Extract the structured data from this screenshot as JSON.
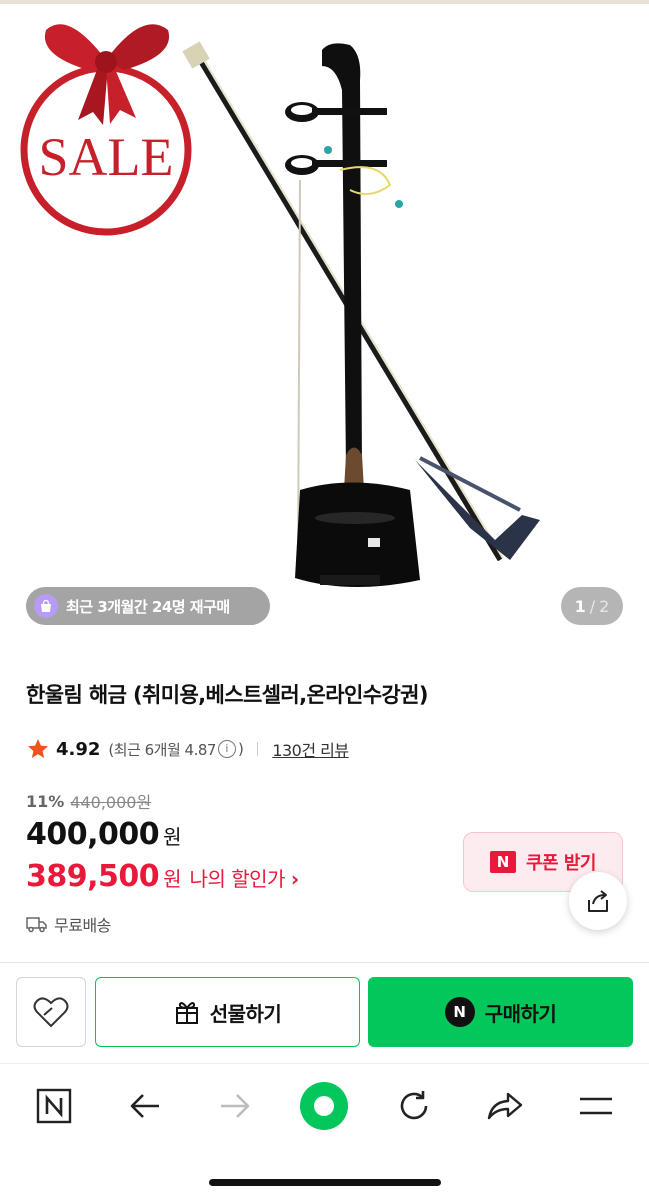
{
  "hero": {
    "sale_text": "SALE",
    "rebuy_badge": "최근 3개월간 24명 재구매",
    "page_current": "1",
    "page_separator": "/",
    "page_total": "2"
  },
  "product": {
    "title": "한울림 해금 (취미용,베스트셀러,온라인수강권)",
    "rating": "4.92",
    "rating_recent_prefix": "(최근 6개월 4.87",
    "rating_info_symbol": "i",
    "rating_recent_suffix": ")",
    "review_link": "130건 리뷰",
    "discount_percent": "11%",
    "original_price": "440,000원",
    "price": "400,000",
    "price_unit": "원",
    "my_price": "389,500",
    "my_price_unit": "원",
    "my_price_label": "나의 할인가",
    "my_price_chevron": "›",
    "coupon_label": "쿠폰 받기",
    "coupon_icon_letter": "N",
    "shipping": "무료배송"
  },
  "actions": {
    "gift_label": "선물하기",
    "buy_label": "구매하기",
    "buy_icon_letter": "N"
  },
  "colors": {
    "accent_green": "#03c75a",
    "discount_red": "#e8193b",
    "star_orange": "#f0531c"
  },
  "toolbar": {
    "icons": [
      "naver-home-icon",
      "back-arrow-icon",
      "forward-arrow-icon",
      "green-dot-icon",
      "reload-icon",
      "share-arrow-icon",
      "menu-icon"
    ]
  }
}
